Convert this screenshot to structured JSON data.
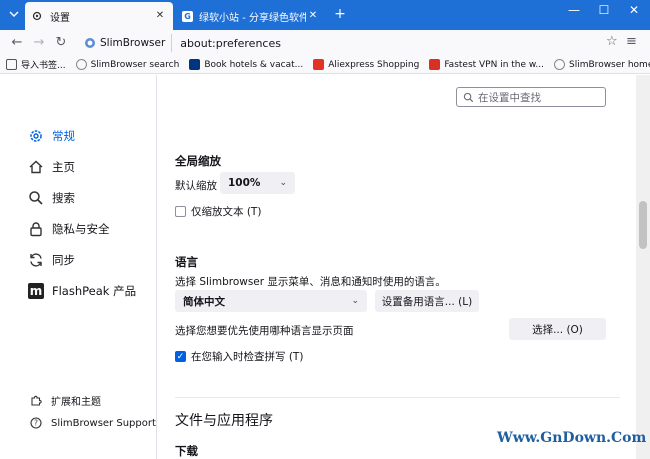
{
  "tabs": [
    {
      "title": "设置",
      "icon": "gear-icon",
      "active": true
    },
    {
      "title": "绿软小站 - 分享绿色软件、免费",
      "icon": "favicon-icon",
      "favicon_glyph": "G",
      "active": false
    }
  ],
  "navbar": {
    "identity": "SlimBrowser",
    "url": "about:preferences"
  },
  "bookmarks": [
    {
      "label": "导入书签...",
      "icon_color": "#555555"
    },
    {
      "label": "SlimBrowser search",
      "icon_color": "#888888"
    },
    {
      "label": "Book hotels & vacat...",
      "icon_color": "#003580"
    },
    {
      "label": "Aliexpress Shopping",
      "icon_color": "#e43225"
    },
    {
      "label": "Fastest VPN in the w...",
      "icon_color": "#d93025"
    },
    {
      "label": "SlimBrowser homep...",
      "icon_color": "#888888"
    }
  ],
  "sidebar": {
    "categories": [
      {
        "label": "常规",
        "icon": "gear-icon",
        "selected": true
      },
      {
        "label": "主页",
        "icon": "home-icon",
        "selected": false
      },
      {
        "label": "搜索",
        "icon": "search-icon",
        "selected": false
      },
      {
        "label": "隐私与安全",
        "icon": "lock-icon",
        "selected": false
      },
      {
        "label": "同步",
        "icon": "sync-icon",
        "selected": false
      },
      {
        "label": "FlashPeak 产品",
        "icon": "flashpeak-icon",
        "icon_glyph": "m",
        "selected": false
      }
    ],
    "footer": [
      {
        "label": "扩展和主题",
        "icon": "puzzle-icon"
      },
      {
        "label": "SlimBrowser Support",
        "icon": "help-icon"
      }
    ]
  },
  "search": {
    "placeholder": "在设置中查找"
  },
  "zoom": {
    "heading": "全局缩放",
    "default_label": "默认缩放",
    "default_value": "100%",
    "text_only_label": "仅缩放文本 (T)",
    "text_only_checked": false
  },
  "language": {
    "heading": "语言",
    "description": "选择 Slimbrowser 显示菜单、消息和通知时使用的语言。",
    "selected": "简体中文",
    "alternatives_button": "设置备用语言... (L)",
    "pages_label": "选择您想要优先使用哪种语言显示页面",
    "choose_button": "选择... (O)",
    "spellcheck_label": "在您输入时检查拼写 (T)",
    "spellcheck_checked": true
  },
  "files": {
    "heading": "文件与应用程序",
    "downloads": "下载"
  },
  "watermark": "Www.GnDown.Com",
  "colors": {
    "accent": "#0061e0",
    "titlebar": "#1e6fd6"
  }
}
